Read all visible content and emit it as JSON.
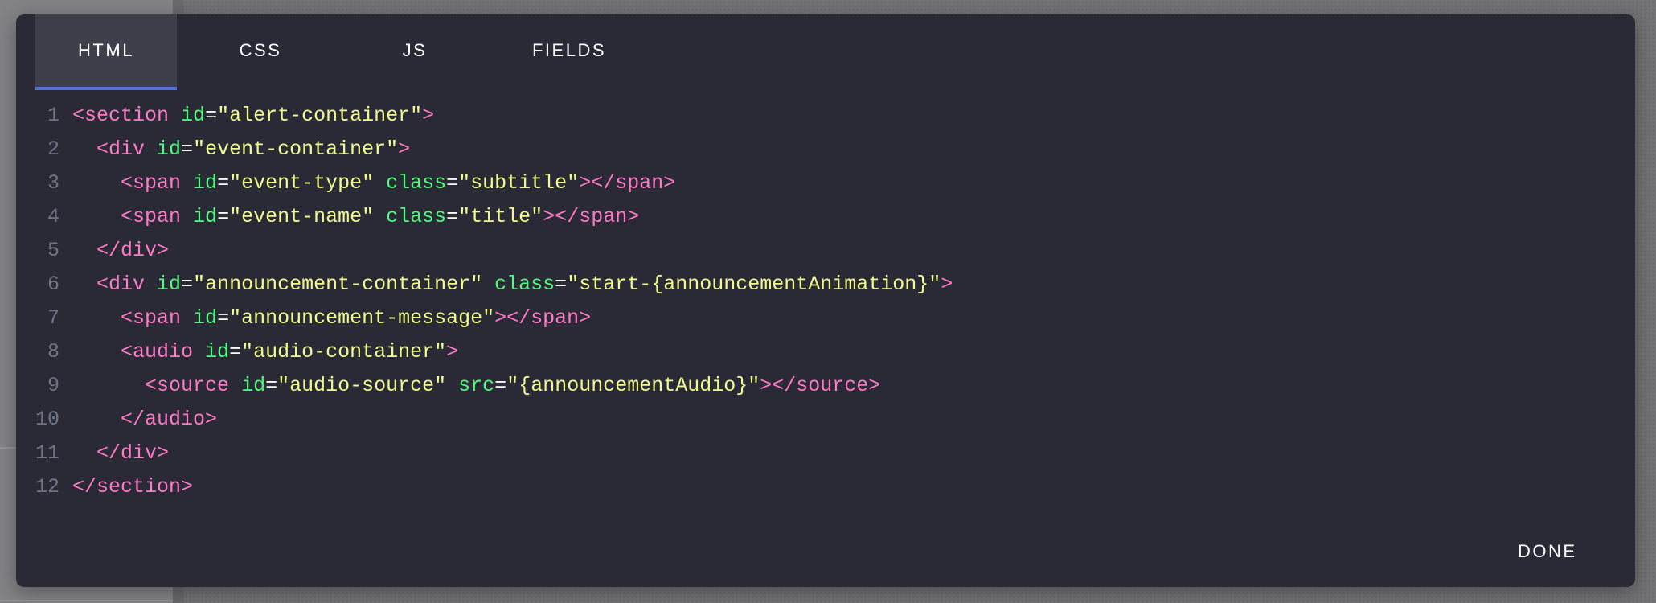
{
  "dialog": {
    "tabs": [
      {
        "label": "HTML",
        "active": true
      },
      {
        "label": "CSS",
        "active": false
      },
      {
        "label": "JS",
        "active": false
      },
      {
        "label": "FIELDS",
        "active": false
      }
    ],
    "done_label": "DONE",
    "colors": {
      "background": "#292a36",
      "active_tab_background": "#3d3f4b",
      "active_tab_underline": "#5470d6",
      "tag": "#ff79c6",
      "attribute": "#50fa7b",
      "string": "#f1fa8c",
      "line_number": "#6f7584"
    }
  },
  "editor": {
    "lines": [
      {
        "number": "1",
        "tokens": [
          {
            "t": "tag",
            "v": "<section"
          },
          {
            "t": "punct",
            "v": " "
          },
          {
            "t": "attr",
            "v": "id"
          },
          {
            "t": "punct",
            "v": "="
          },
          {
            "t": "str",
            "v": "\"alert-container\""
          },
          {
            "t": "tag",
            "v": ">"
          }
        ]
      },
      {
        "number": "2",
        "tokens": [
          {
            "t": "punct",
            "v": "  "
          },
          {
            "t": "tag",
            "v": "<div"
          },
          {
            "t": "punct",
            "v": " "
          },
          {
            "t": "attr",
            "v": "id"
          },
          {
            "t": "punct",
            "v": "="
          },
          {
            "t": "str",
            "v": "\"event-container\""
          },
          {
            "t": "tag",
            "v": ">"
          }
        ]
      },
      {
        "number": "3",
        "tokens": [
          {
            "t": "punct",
            "v": "    "
          },
          {
            "t": "tag",
            "v": "<span"
          },
          {
            "t": "punct",
            "v": " "
          },
          {
            "t": "attr",
            "v": "id"
          },
          {
            "t": "punct",
            "v": "="
          },
          {
            "t": "str",
            "v": "\"event-type\""
          },
          {
            "t": "punct",
            "v": " "
          },
          {
            "t": "attr",
            "v": "class"
          },
          {
            "t": "punct",
            "v": "="
          },
          {
            "t": "str",
            "v": "\"subtitle\""
          },
          {
            "t": "tag",
            "v": "></span>"
          }
        ]
      },
      {
        "number": "4",
        "tokens": [
          {
            "t": "punct",
            "v": "    "
          },
          {
            "t": "tag",
            "v": "<span"
          },
          {
            "t": "punct",
            "v": " "
          },
          {
            "t": "attr",
            "v": "id"
          },
          {
            "t": "punct",
            "v": "="
          },
          {
            "t": "str",
            "v": "\"event-name\""
          },
          {
            "t": "punct",
            "v": " "
          },
          {
            "t": "attr",
            "v": "class"
          },
          {
            "t": "punct",
            "v": "="
          },
          {
            "t": "str",
            "v": "\"title\""
          },
          {
            "t": "tag",
            "v": "></span>"
          }
        ]
      },
      {
        "number": "5",
        "tokens": [
          {
            "t": "punct",
            "v": "  "
          },
          {
            "t": "tag",
            "v": "</div>"
          }
        ]
      },
      {
        "number": "6",
        "tokens": [
          {
            "t": "punct",
            "v": "  "
          },
          {
            "t": "tag",
            "v": "<div"
          },
          {
            "t": "punct",
            "v": " "
          },
          {
            "t": "attr",
            "v": "id"
          },
          {
            "t": "punct",
            "v": "="
          },
          {
            "t": "str",
            "v": "\"announcement-container\""
          },
          {
            "t": "punct",
            "v": " "
          },
          {
            "t": "attr",
            "v": "class"
          },
          {
            "t": "punct",
            "v": "="
          },
          {
            "t": "str",
            "v": "\"start-{announcementAnimation}\""
          },
          {
            "t": "tag",
            "v": ">"
          }
        ]
      },
      {
        "number": "7",
        "tokens": [
          {
            "t": "punct",
            "v": "    "
          },
          {
            "t": "tag",
            "v": "<span"
          },
          {
            "t": "punct",
            "v": " "
          },
          {
            "t": "attr",
            "v": "id"
          },
          {
            "t": "punct",
            "v": "="
          },
          {
            "t": "str",
            "v": "\"announcement-message\""
          },
          {
            "t": "tag",
            "v": "></span>"
          }
        ]
      },
      {
        "number": "8",
        "tokens": [
          {
            "t": "punct",
            "v": "    "
          },
          {
            "t": "tag",
            "v": "<audio"
          },
          {
            "t": "punct",
            "v": " "
          },
          {
            "t": "attr",
            "v": "id"
          },
          {
            "t": "punct",
            "v": "="
          },
          {
            "t": "str",
            "v": "\"audio-container\""
          },
          {
            "t": "tag",
            "v": ">"
          }
        ]
      },
      {
        "number": "9",
        "tokens": [
          {
            "t": "punct",
            "v": "      "
          },
          {
            "t": "tag",
            "v": "<source"
          },
          {
            "t": "punct",
            "v": " "
          },
          {
            "t": "attr",
            "v": "id"
          },
          {
            "t": "punct",
            "v": "="
          },
          {
            "t": "str",
            "v": "\"audio-source\""
          },
          {
            "t": "punct",
            "v": " "
          },
          {
            "t": "attr",
            "v": "src"
          },
          {
            "t": "punct",
            "v": "="
          },
          {
            "t": "str",
            "v": "\"{announcementAudio}\""
          },
          {
            "t": "tag",
            "v": "></source>"
          }
        ]
      },
      {
        "number": "10",
        "tokens": [
          {
            "t": "punct",
            "v": "    "
          },
          {
            "t": "tag",
            "v": "</audio>"
          }
        ]
      },
      {
        "number": "11",
        "tokens": [
          {
            "t": "punct",
            "v": "  "
          },
          {
            "t": "tag",
            "v": "</div>"
          }
        ]
      },
      {
        "number": "12",
        "tokens": [
          {
            "t": "tag",
            "v": "</section>"
          }
        ]
      }
    ]
  }
}
